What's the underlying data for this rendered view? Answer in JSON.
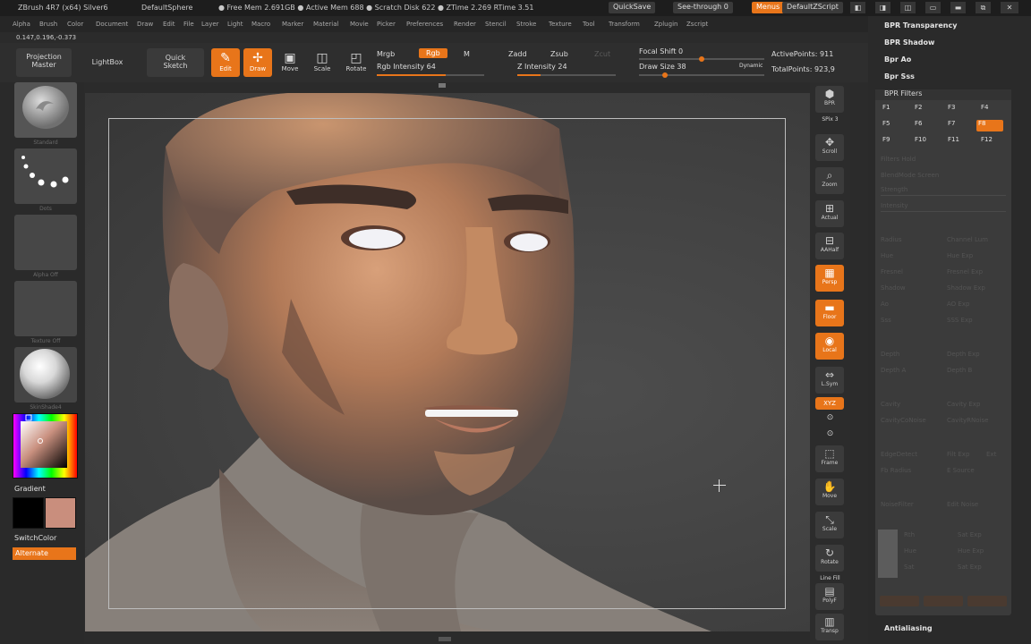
{
  "titlebar": {
    "app": "ZBrush 4R7 (x64) Silver6",
    "project": "DefaultSphere",
    "status": "● Free Mem 2.691GB ● Active Mem 688 ● Scratch Disk 622 ● ZTime 2.269 RTime 3.51",
    "quicksave": "QuickSave",
    "seethrough": "See-through 0",
    "menus": "Menus",
    "script": "DefaultZScript",
    "win_buttons": [
      "◧",
      "◨",
      "◫",
      "▭",
      "▬",
      "⧉",
      "✕"
    ]
  },
  "menubar": {
    "items": [
      "Alpha",
      "Brush",
      "Color",
      "Document",
      "Draw",
      "Edit",
      "File",
      "Layer",
      "Light",
      "Macro",
      "Marker",
      "Material",
      "Movie",
      "Picker",
      "Preferences",
      "Render",
      "Stencil",
      "Stroke",
      "Texture",
      "Tool",
      "Transform",
      "Zplugin",
      "Zscript"
    ]
  },
  "coords": "0.147,0.196,-0.373",
  "toolbar": {
    "projection_master": "Projection\nMaster",
    "lightbox": "LightBox",
    "quick_sketch": "Quick\nSketch",
    "edit": "Edit",
    "draw": "Draw",
    "move": "Move",
    "scale": "Scale",
    "rotate": "Rotate",
    "mrgb": "Mrgb",
    "rgb": "Rgb",
    "m": "M",
    "rgb_intensity": "Rgb Intensity 64",
    "zadd": "Zadd",
    "zsub": "Zsub",
    "zcut": "Zcut",
    "z_intensity": "Z Intensity 24",
    "focal_shift": "Focal Shift 0",
    "draw_size": "Draw Size 38",
    "dynamic": "Dynamic",
    "active_points": "ActivePoints: 911",
    "total_points": "TotalPoints: 923,9",
    "rgb_intensity_value": 64,
    "z_intensity_value": 24,
    "draw_size_value": 38
  },
  "leftshelf": {
    "material_caption": "Standard",
    "stroke_caption": "Dots",
    "alpha_caption": "Alpha Off",
    "texture_caption": "Texture Off",
    "matcap_caption": "SkinShade4",
    "gradient": "Gradient",
    "switch_color": "SwitchColor",
    "alternate": "Alternate",
    "swatch_main": "#000000",
    "swatch_secondary": "#c98e7d"
  },
  "rightshelf": {
    "buttons": [
      {
        "icon": "⬢",
        "label": "BPR"
      },
      {
        "icon": "✥",
        "label": "Scroll"
      },
      {
        "icon": "⌕",
        "label": "Zoom"
      },
      {
        "icon": "⊞",
        "label": "Actual"
      },
      {
        "icon": "⊟",
        "label": "AAHalf"
      },
      {
        "icon": "▦",
        "label": "Persp"
      },
      {
        "icon": "▬",
        "label": "Floor"
      },
      {
        "icon": "◉",
        "label": "Local"
      },
      {
        "icon": "⇔",
        "label": "L.Sym"
      },
      {
        "icon": "⬚",
        "label": "Frame"
      },
      {
        "icon": "✋",
        "label": "Move"
      },
      {
        "icon": "⤡",
        "label": "Scale"
      },
      {
        "icon": "↻",
        "label": "Rotate"
      },
      {
        "icon": "▤",
        "label": "PolyF"
      },
      {
        "icon": "▥",
        "label": "Transp"
      }
    ],
    "spix": "SPix 3",
    "xyz": "XYZ",
    "line_fill": "Line Fill"
  },
  "tray": {
    "bpr_transparency": "BPR Transparency",
    "bpr_shadow": "BPR Shadow",
    "bpr_ao": "Bpr Ao",
    "bpr_sss": "Bpr Sss",
    "bpr_filters": "BPR Filters",
    "fkeys": [
      "F1",
      "F2",
      "F3",
      "F4",
      "F5",
      "F6",
      "F7",
      "F8",
      "F9",
      "F10",
      "F11",
      "F12"
    ],
    "active_fkey": "F8",
    "params": [
      "Filters Hold",
      "BlendMode Screen",
      "Strength",
      "Intensity",
      "Radius",
      "Channel Lum",
      "Hue",
      "Hue Exp",
      "Fresnel",
      "Fresnel Exp",
      "Shadow",
      "Shadow Exp",
      "Ao",
      "AO Exp",
      "Sss",
      "SSS Exp",
      "Depth",
      "Depth Exp",
      "Depth A",
      "Depth B",
      "Cavity",
      "Cavity Exp",
      "CavityCoNoise",
      "CavityRNoise",
      "EdgeDetect",
      "Filt Exp",
      "Ext",
      "Fb Radius",
      "E Source",
      "NoiseFilter",
      "Edit Noise",
      "Rth",
      "Sat Exp",
      "Hue",
      "Hue Exp",
      "Sat",
      "Sat Exp"
    ],
    "antialiasing": "Antialiasing"
  },
  "colors": {
    "accent": "#e8751a",
    "background": "#2b2b2b",
    "viewport": "#444444"
  }
}
